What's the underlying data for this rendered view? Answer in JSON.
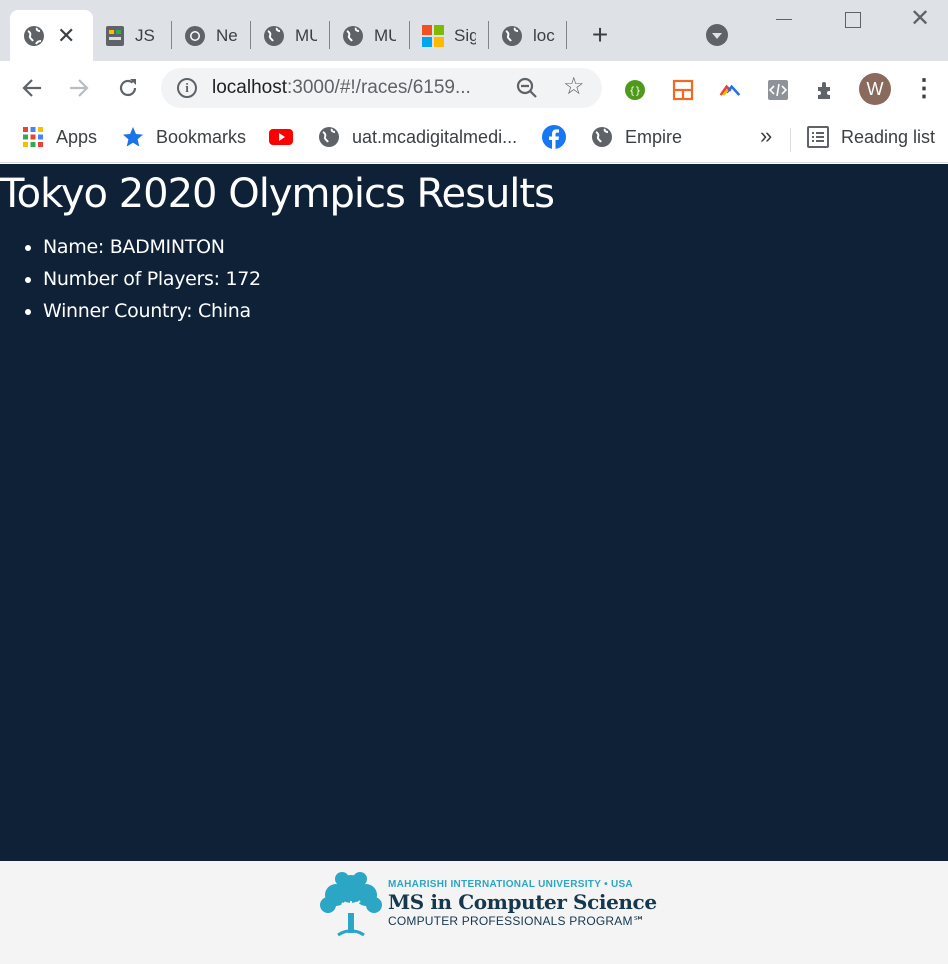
{
  "tabs": [
    {
      "title": "",
      "icon": "globe-icon",
      "active": true
    },
    {
      "title": "JS",
      "icon": "js-icon"
    },
    {
      "title": "Ne",
      "icon": "chrome-icon"
    },
    {
      "title": "MU",
      "icon": "globe-icon"
    },
    {
      "title": "MU",
      "icon": "globe-icon"
    },
    {
      "title": "Sig",
      "icon": "microsoft-icon"
    },
    {
      "title": "loc",
      "icon": "globe-icon"
    }
  ],
  "toolbar": {
    "url_host": "localhost",
    "url_path": ":3000/#!/races/6159...",
    "avatar_initial": "W"
  },
  "bookmarks": {
    "apps": "Apps",
    "bookmarks": "Bookmarks",
    "uat": "uat.mcadigitalmedi...",
    "empire": "Empire",
    "more": "»",
    "reading_list": "Reading list"
  },
  "page": {
    "title": "Tokyo 2020 Olympics Results",
    "details": [
      "Name: BADMINTON",
      "Number of Players: 172",
      "Winner Country: China"
    ]
  },
  "footer": {
    "university": "MAHARISHI INTERNATIONAL UNIVERSITY • USA",
    "program": "MS in Computer Science",
    "subtitle": "COMPUTER PROFESSIONALS PROGRAM℠"
  },
  "colors": {
    "page_bg": "#0f2137",
    "page_text": "#ffffff",
    "footer_bg": "#f4f4f4",
    "logo_teal": "#2ba6c4",
    "logo_navy": "#15384f"
  }
}
